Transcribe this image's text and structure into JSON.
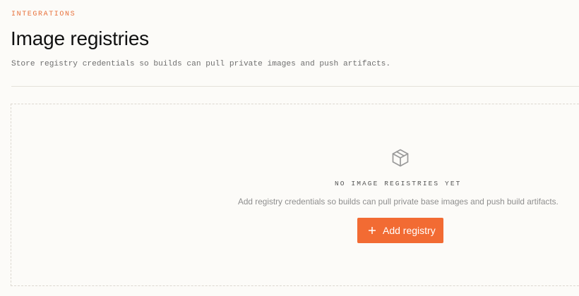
{
  "header": {
    "eyebrow": "INTEGRATIONS",
    "title": "Image registries",
    "subtitle": "Store registry credentials so builds can pull private images and push artifacts."
  },
  "empty_state": {
    "icon": "package-icon",
    "title": "NO IMAGE REGISTRIES YET",
    "description": "Add registry credentials so builds can pull private base images and push build artifacts.",
    "button": {
      "icon": "plus-icon",
      "label": "Add registry"
    }
  },
  "colors": {
    "accent": "#f26b33",
    "eyebrow": "#e8703a",
    "background": "#fcfbf8"
  }
}
